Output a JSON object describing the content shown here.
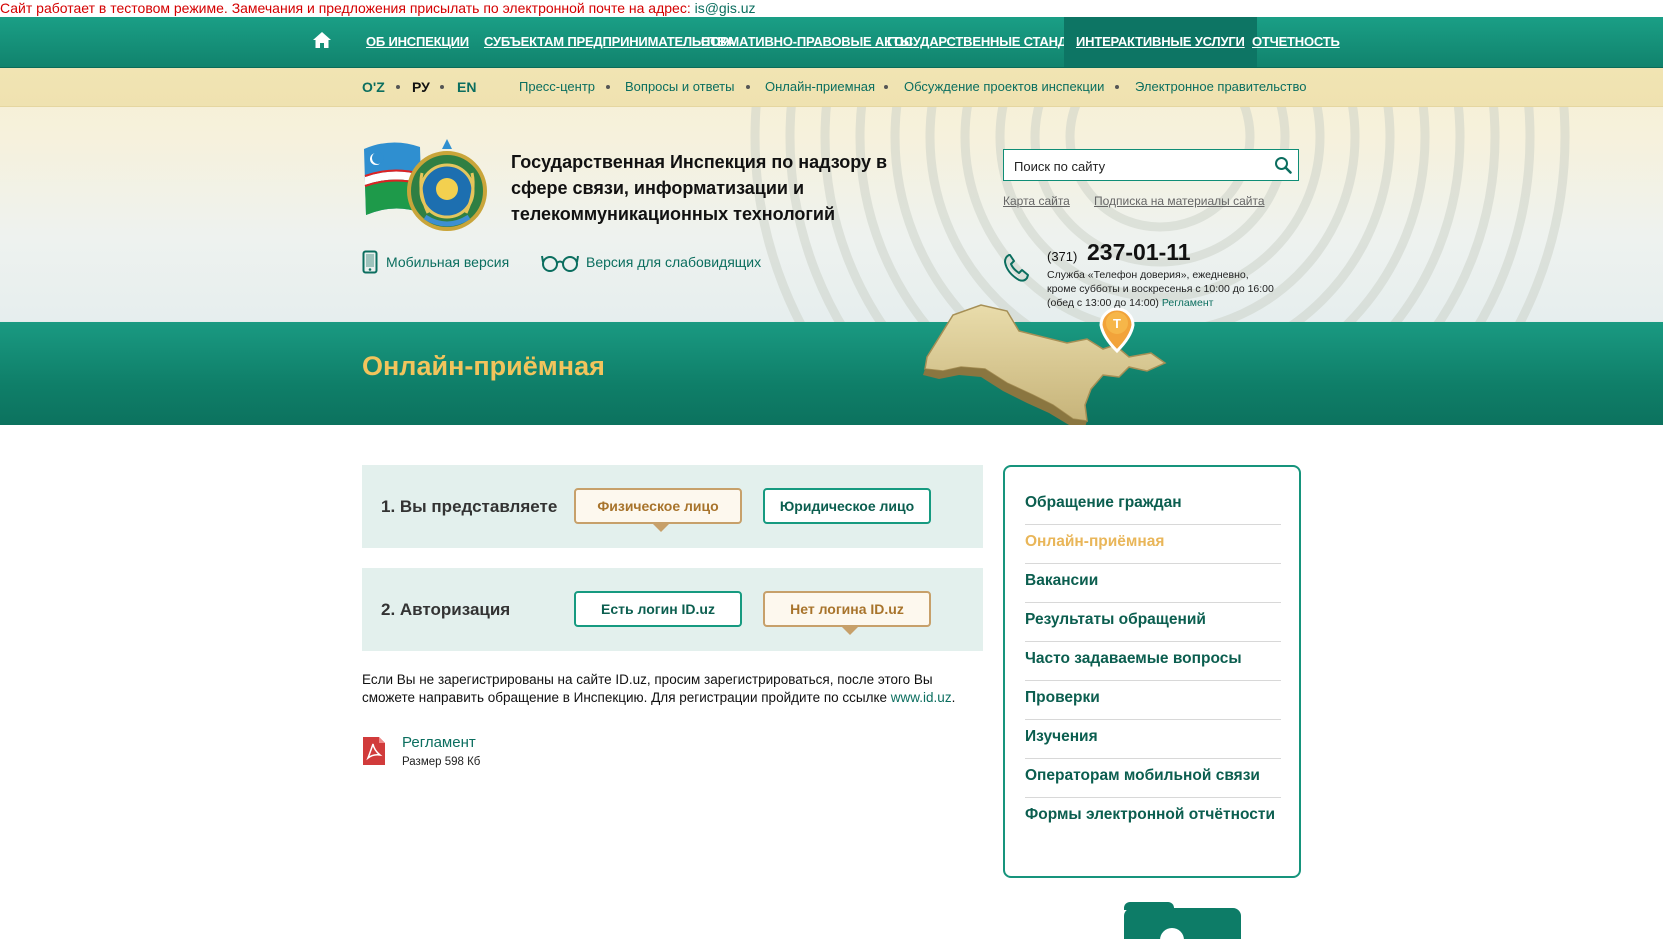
{
  "notice": {
    "text": "Сайт работает в тестовом режиме. Замечания и предложения присылать по электронной почте на адрес: ",
    "email": "is@gis.uz"
  },
  "topnav": {
    "items": [
      {
        "label": "ОБ ИНСПЕКЦИИ"
      },
      {
        "label": "СУБЪЕКТАМ ПРЕДПРИНИМАТЕЛЬСТВА"
      },
      {
        "label": "НОРМАТИВНО-ПРАВОВЫЕ АКТЫ"
      },
      {
        "label": "ГОСУДАРСТВЕННЫЕ СТАНДАРТЫ"
      },
      {
        "label": "ИНТЕРАКТИВНЫЕ УСЛУГИ"
      },
      {
        "label": "ОТЧЕТНОСТЬ"
      }
    ],
    "active": "ИНТЕРАКТИВНЫЕ УСЛУГИ"
  },
  "languages": [
    "O'Z",
    "РУ",
    "EN"
  ],
  "current_language": "РУ",
  "subnav": [
    "Пресс-центр",
    "Вопросы и ответы",
    "Онлайн-приемная",
    "Обсуждение проектов инспекции",
    "Электронное правительство"
  ],
  "header": {
    "title": "Государственная Инспекция по надзору в сфере связи, информатизации и телекоммуникационных технологий",
    "mobile_version": "Мобильная версия",
    "low_vision_version": "Версия для слабовидящих"
  },
  "search": {
    "placeholder": "Поиск по сайту"
  },
  "util_links": [
    "Карта сайта",
    "Подписка на материалы сайта"
  ],
  "phone": {
    "code": "(371)",
    "number": "237-01-11",
    "desc_1": "Служба «Телефон доверия», ежедневно,",
    "desc_2": "кроме субботы и воскресенья с 10:00 до 16:00",
    "desc_3": "(обед с 13:00 до 14:00)",
    "reglament": "Регламент"
  },
  "map_marker": "T",
  "page_title": "Онлайн-приёмная",
  "step1": {
    "label": "1. Вы представляете",
    "options": [
      "Физическое лицо",
      "Юридическое лицо"
    ]
  },
  "step2": {
    "label": "2. Авторизация",
    "options": [
      "Есть логин ID.uz",
      "Нет логина ID.uz"
    ]
  },
  "note": {
    "text": "Если Вы не зарегистрированы на сайте ID.uz, просим зарегистрироваться, после этого Вы сможете направить обращение в Инспекцию. Для регистрации пройдите по ссылке ",
    "link": "www.id.uz",
    "end": "."
  },
  "document": {
    "name": "Регламент",
    "size": "Размер 598 Кб"
  },
  "sidebar": {
    "items": [
      "Обращение граждан",
      "Онлайн-приёмная",
      "Вакансии",
      "Результаты обращений",
      "Часто задаваемые вопросы",
      "Проверки",
      "Изучения",
      "Операторам мобильной связи",
      "Формы электронной отчётности"
    ],
    "active": "Онлайн-приёмная"
  },
  "colors": {
    "brand_green": "#11836d",
    "accent_gold": "#f2c45c",
    "notice_red": "#d40000"
  }
}
